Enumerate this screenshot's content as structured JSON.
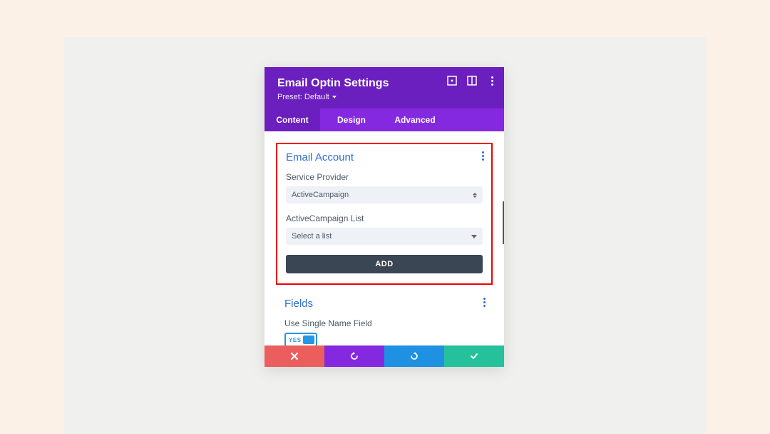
{
  "header": {
    "title": "Email Optin Settings",
    "preset_label": "Preset: Default"
  },
  "tabs": {
    "content": "Content",
    "design": "Design",
    "advanced": "Advanced"
  },
  "email_account": {
    "title": "Email Account",
    "service_provider_label": "Service Provider",
    "service_provider_value": "ActiveCampaign",
    "list_label": "ActiveCampaign List",
    "list_value": "Select a list",
    "add_button": "ADD"
  },
  "fields": {
    "title": "Fields",
    "single_name_label": "Use Single Name Field",
    "toggle_value": "YES"
  }
}
